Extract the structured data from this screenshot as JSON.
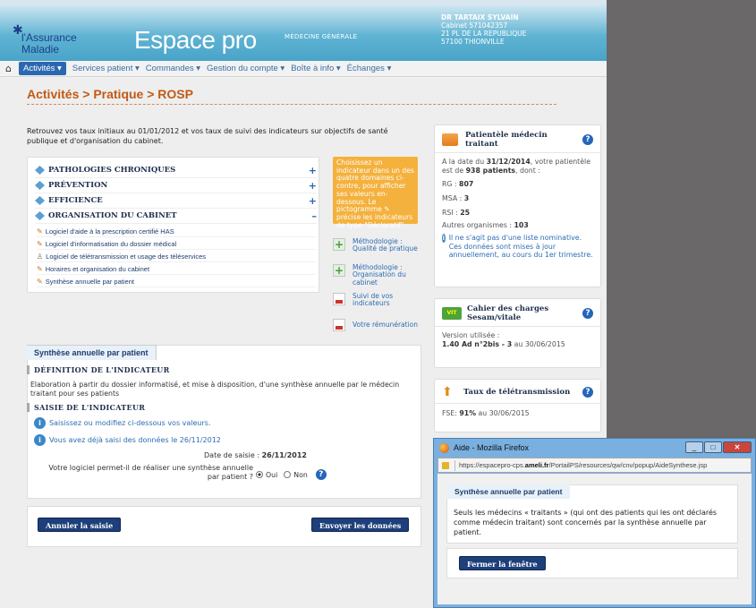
{
  "header": {
    "logo_text": "l'Assurance\nMaladie",
    "app_title": "Espace pro",
    "subtitle": "MÉDECINE GÉNÉRALE",
    "user": {
      "name": "DR TARTAIX SYLVAIN",
      "line1": "Cabinet 571042357",
      "line2": "21 PL DE LA REPUBLIQUE",
      "line3": "57100 THIONVILLE"
    }
  },
  "nav": {
    "items": [
      "Activités ▾",
      "Services patient ▾",
      "Commandes ▾",
      "Gestion du compte ▾",
      "Boîte à info ▾",
      "Échanges ▾"
    ]
  },
  "page": {
    "title": "Activités > Pratique > ROSP",
    "intro": "Retrouvez vos taux initiaux au 01/01/2012 et vos taux de suivi des indicateurs sur objectifs de santé publique et d'organisation du cabinet."
  },
  "categories": [
    {
      "label": "PATHOLOGIES CHRONIQUES",
      "toggle": "+"
    },
    {
      "label": "PRÉVENTION",
      "toggle": "+"
    },
    {
      "label": "EFFICIENCE",
      "toggle": "+"
    },
    {
      "label": "ORGANISATION DU CABINET",
      "toggle": "–"
    }
  ],
  "sub_items": [
    "Logiciel d'aide à la prescription certifié HAS",
    "Logiciel d'informatisation du dossier médical",
    "Logiciel de télétransmission et usage des téléservices",
    "Horaires et organisation du cabinet",
    "Synthèse annuelle par patient"
  ],
  "note": "Choisissez un indicateur dans un des quatre domaines ci-contre, pour afficher ses valeurs en-dessous. Le pictogramme ✎ précise les indicateurs de type \"Déclaratif\".",
  "links": {
    "method1": "Méthodologie : Qualité de pratique",
    "method2": "Méthodologie : Organisation du cabinet",
    "suivi": "Suivi de vos indicateurs",
    "remuneration": "Votre rémunération"
  },
  "patientele": {
    "title": "Patientèle médecin traitant",
    "line1_pre": "A la date du ",
    "date": "31/12/2014",
    "line1_mid": ", votre patientèle est de ",
    "count": "938 patients",
    "line1_post": ", dont :",
    "rg_label": "RG : ",
    "rg": "807",
    "msa_label": "MSA : ",
    "msa": "3",
    "rsi_label": "RSI : ",
    "rsi": "25",
    "autres_label": "Autres organismes : ",
    "autres": "103",
    "info": "Il ne s'agit pas d'une liste nominative. Ces données sont mises à jour annuellement, au cours du 1er trimestre."
  },
  "cahier": {
    "title": "Cahier des charges Sesam/vitale",
    "version_label": "Version utilisée :",
    "version": "1.40 Ad n°2bis - 3",
    "version_date": " au 30/06/2015"
  },
  "teletrans": {
    "title": "Taux de télétransmission",
    "fse_label": "FSE: ",
    "fse_value": "91%",
    "fse_date": " au 30/06/2015"
  },
  "synthese": {
    "tab": "Synthèse annuelle par patient",
    "def_title": "DÉFINITION DE L'INDICATEUR",
    "def_text": "Elaboration à partir du dossier informatisé, et mise à disposition, d'une synthèse annuelle par le médecin traitant pour ses patients",
    "saisie_title": "SAISIE DE L'INDICATEUR",
    "info1": "Saisissez ou modifiez ci-dessous vos valeurs.",
    "info2": "Vous avez déjà saisi des données le 26/11/2012",
    "date_label": "Date de saisie : ",
    "date_value": "26/11/2012",
    "question": "Votre logiciel permet-il de réaliser une synthèse annuelle par patient ?",
    "oui": "Oui",
    "non": "Non"
  },
  "actions": {
    "cancel": "Annuler la saisie",
    "send": "Envoyer les données"
  },
  "popup": {
    "window_title": "Aide - Mozilla Firefox",
    "url_prefix": "https://espacepro-cps.",
    "url_domain": "ameli.fr",
    "url_suffix": "/PortailPS/resources/qw/cnv/popup/AideSynthese.jsp",
    "card_title": "Synthèse annuelle par patient",
    "text": "Seuls les médecins « traitants » (qui ont des patients qui les ont déclarés comme médecin traitant) sont concernés par la synthèse annuelle par patient.",
    "close_button": "Fermer la fenêtre"
  }
}
